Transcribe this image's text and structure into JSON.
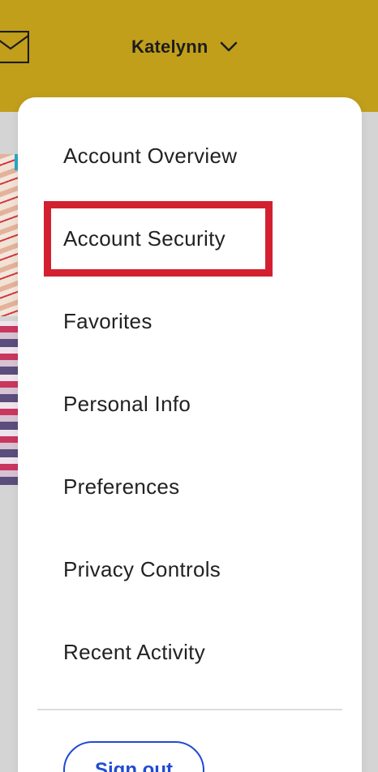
{
  "header": {
    "background_color": "#c19f1b",
    "mail_icon": "envelope-icon",
    "user_name": "Katelynn",
    "dropdown_icon": "chevron-down-icon"
  },
  "menu": {
    "items": [
      {
        "label": "Account Overview"
      },
      {
        "label": "Account Security",
        "highlighted": true
      },
      {
        "label": "Favorites"
      },
      {
        "label": "Personal Info"
      },
      {
        "label": "Preferences"
      },
      {
        "label": "Privacy Controls"
      },
      {
        "label": "Recent Activity"
      }
    ],
    "sign_out_label": "Sign out",
    "highlight_color": "#d32030",
    "sign_out_color": "#1f4bd1"
  }
}
